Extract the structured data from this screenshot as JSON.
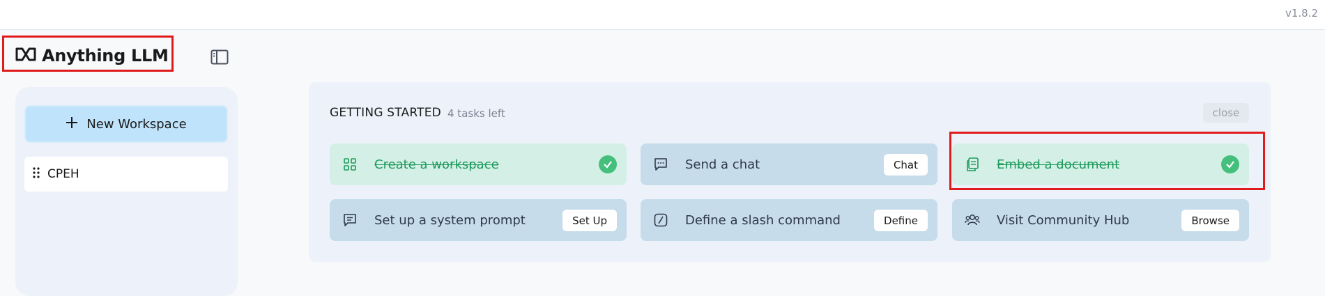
{
  "app": {
    "version": "v1.8.2",
    "logo_text": "Anything LLM"
  },
  "sidebar": {
    "new_workspace_label": "New Workspace",
    "workspaces": [
      {
        "name": "CPEH"
      }
    ]
  },
  "getting_started": {
    "title": "GETTING STARTED",
    "tasks_left": "4 tasks left",
    "close_label": "close",
    "tasks": [
      {
        "label": "Create a workspace",
        "status": "done",
        "icon": "grid-icon"
      },
      {
        "label": "Send a chat",
        "status": "todo",
        "icon": "chat-icon",
        "button": "Chat"
      },
      {
        "label": "Embed a document",
        "status": "done",
        "icon": "document-icon"
      },
      {
        "label": "Set up a system prompt",
        "status": "todo",
        "icon": "prompt-icon",
        "button": "Set Up"
      },
      {
        "label": "Define a slash command",
        "status": "todo",
        "icon": "slash-icon",
        "button": "Define"
      },
      {
        "label": "Visit Community Hub",
        "status": "todo",
        "icon": "users-icon",
        "button": "Browse"
      }
    ]
  },
  "colors": {
    "highlight": "#e01b1b",
    "done_bg": "#d4f0e6",
    "done_text": "#1e9a5c",
    "todo_bg": "#c6dcea",
    "new_workspace_bg": "#bfe3fb",
    "check": "#45c07c"
  }
}
